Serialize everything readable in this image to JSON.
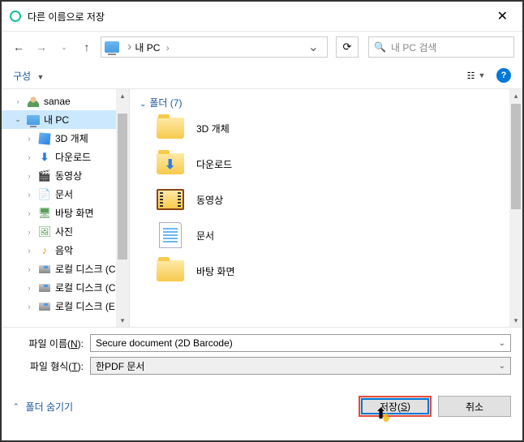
{
  "titlebar": {
    "title": "다른 이름으로 저장"
  },
  "nav": {
    "breadcrumb": "내 PC",
    "search_placeholder": "내 PC 검색"
  },
  "toolbar": {
    "organize": "구성"
  },
  "tree": {
    "items": [
      {
        "label": "sanae",
        "indent": 1,
        "chev": "›",
        "icon": "user"
      },
      {
        "label": "내 PC",
        "indent": 1,
        "chev": "⌄",
        "icon": "pc",
        "selected": true
      },
      {
        "label": "3D 개체",
        "indent": 2,
        "chev": "›",
        "icon": "3d"
      },
      {
        "label": "다운로드",
        "indent": 2,
        "chev": "›",
        "icon": "dl"
      },
      {
        "label": "동영상",
        "indent": 2,
        "chev": "›",
        "icon": "video"
      },
      {
        "label": "문서",
        "indent": 2,
        "chev": "›",
        "icon": "docs"
      },
      {
        "label": "바탕 화면",
        "indent": 2,
        "chev": "›",
        "icon": "desktop"
      },
      {
        "label": "사진",
        "indent": 2,
        "chev": "›",
        "icon": "pic"
      },
      {
        "label": "음악",
        "indent": 2,
        "chev": "›",
        "icon": "music"
      },
      {
        "label": "로컬 디스크 (C",
        "indent": 2,
        "chev": "›",
        "icon": "disk"
      },
      {
        "label": "로컬 디스크 (C",
        "indent": 2,
        "chev": "›",
        "icon": "disk"
      },
      {
        "label": "로컬 디스크 (E",
        "indent": 2,
        "chev": "›",
        "icon": "disk"
      }
    ]
  },
  "content": {
    "group_header": "폴더 (7)",
    "folders": [
      {
        "label": "3D 개체",
        "icon": "f3d"
      },
      {
        "label": "다운로드",
        "icon": "fdl"
      },
      {
        "label": "동영상",
        "icon": "fvideo"
      },
      {
        "label": "문서",
        "icon": "fdoc"
      },
      {
        "label": "바탕 화면",
        "icon": "fdesk"
      }
    ]
  },
  "fields": {
    "filename_label_pre": "파일 이름(",
    "filename_label_u": "N",
    "filename_label_post": "):",
    "filename_value": "Secure document (2D Barcode)",
    "filetype_label_pre": "파일 형식(",
    "filetype_label_u": "T",
    "filetype_label_post": "):",
    "filetype_value": "한PDF 문서"
  },
  "footer": {
    "hide_folders": "폴더 숨기기",
    "save_pre": "저장(",
    "save_u": "S",
    "save_post": ")",
    "cancel": "취소"
  }
}
